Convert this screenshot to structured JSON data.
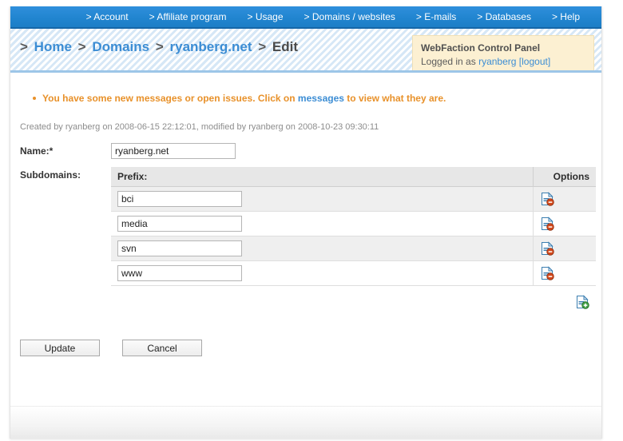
{
  "nav": {
    "items": [
      {
        "label": "> Account",
        "name": "nav-account"
      },
      {
        "label": "> Affiliate program",
        "name": "nav-affiliate-program"
      },
      {
        "label": "> Usage",
        "name": "nav-usage"
      },
      {
        "label": "> Domains / websites",
        "name": "nav-domains-websites"
      },
      {
        "label": "> E-mails",
        "name": "nav-emails"
      },
      {
        "label": "> Databases",
        "name": "nav-databases"
      },
      {
        "label": "> Help",
        "name": "nav-help"
      }
    ]
  },
  "breadcrumb": {
    "sep": ">",
    "home": "Home",
    "domains": "Domains",
    "domain": "ryanberg.net",
    "current": "Edit"
  },
  "userbox": {
    "title": "WebFaction Control Panel",
    "logged_in_prefix": "Logged in as",
    "username": "ryanberg",
    "logout": "[logout]"
  },
  "notice": {
    "text_before": "You have some new messages or open issues. Click on",
    "link": "messages",
    "text_after": "to view what they are."
  },
  "meta": {
    "line": "Created by ryanberg on 2008-06-15 22:12:01, modified by ryanberg on 2008-10-23 09:30:11"
  },
  "form": {
    "name_label": "Name:*",
    "name_value": "ryanberg.net",
    "subdomains_label": "Subdomains:"
  },
  "table": {
    "headers": {
      "prefix": "Prefix:",
      "options": "Options"
    },
    "rows": [
      {
        "prefix": "bci"
      },
      {
        "prefix": "media"
      },
      {
        "prefix": "svn"
      },
      {
        "prefix": "www"
      }
    ]
  },
  "buttons": {
    "update": "Update",
    "cancel": "Cancel"
  },
  "colors": {
    "nav_blue": "#2185d0",
    "link_blue": "#3c8dd4",
    "notice_orange": "#e8912a",
    "userbox_bg": "#fcf0d2",
    "delete_badge": "#d2491d",
    "add_badge": "#43a047"
  }
}
